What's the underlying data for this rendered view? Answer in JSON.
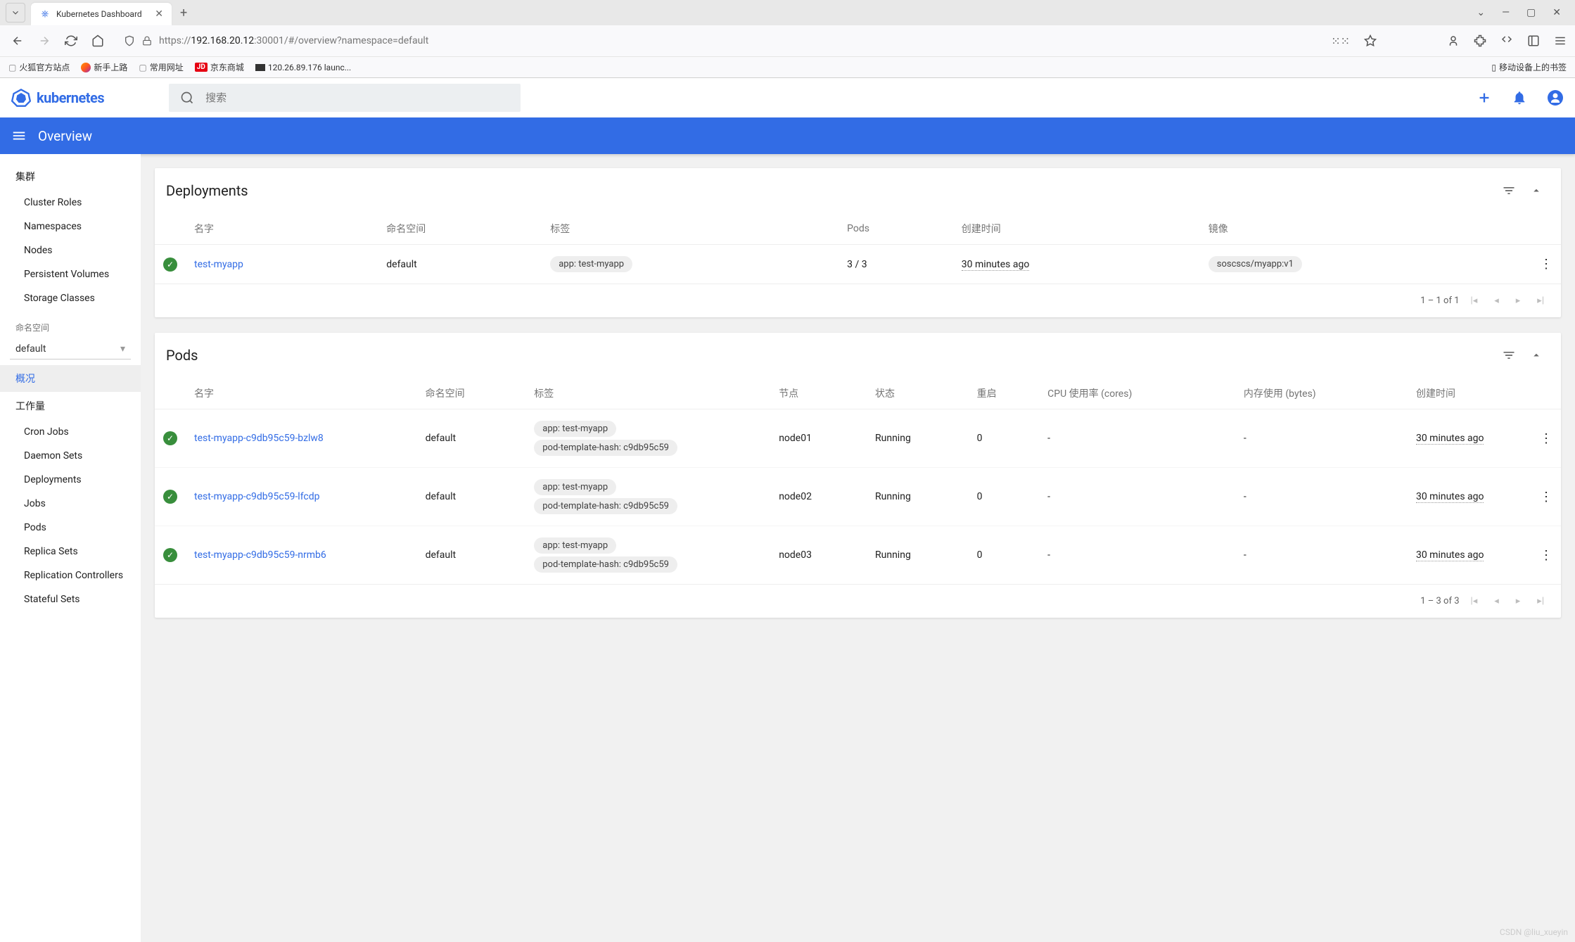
{
  "browser": {
    "tab_title": "Kubernetes Dashboard",
    "url_prefix": "https://",
    "url_host": "192.168.20.12",
    "url_path": ":30001/#/overview?namespace=default",
    "bookmarks": {
      "b1": "火狐官方站点",
      "b2": "新手上路",
      "b3": "常用网址",
      "b4": "京东商城",
      "b5": "120.26.89.176 launc...",
      "mobile": "移动设备上的书签"
    }
  },
  "header": {
    "logo_text": "kubernetes",
    "search_placeholder": "搜索"
  },
  "subheader": {
    "title": "Overview"
  },
  "sidebar": {
    "cluster_heading": "集群",
    "cluster_roles": "Cluster Roles",
    "namespaces": "Namespaces",
    "nodes": "Nodes",
    "persistent_volumes": "Persistent Volumes",
    "storage_classes": "Storage Classes",
    "ns_label": "命名空间",
    "ns_value": "default",
    "overview": "概况",
    "workloads_heading": "工作量",
    "cron_jobs": "Cron Jobs",
    "daemon_sets": "Daemon Sets",
    "deployments": "Deployments",
    "jobs": "Jobs",
    "pods": "Pods",
    "replica_sets": "Replica Sets",
    "replication_controllers": "Replication Controllers",
    "stateful_sets": "Stateful Sets"
  },
  "deployments": {
    "title": "Deployments",
    "headers": {
      "name": "名字",
      "namespace": "命名空间",
      "labels": "标签",
      "pods": "Pods",
      "created": "创建时间",
      "image": "镜像"
    },
    "rows": [
      {
        "name": "test-myapp",
        "namespace": "default",
        "label": "app: test-myapp",
        "pods": "3 / 3",
        "created": "30 minutes ago",
        "image": "soscscs/myapp:v1"
      }
    ],
    "pagination": "1 – 1 of 1"
  },
  "pods": {
    "title": "Pods",
    "headers": {
      "name": "名字",
      "namespace": "命名空间",
      "labels": "标签",
      "node": "节点",
      "status": "状态",
      "restarts": "重启",
      "cpu": "CPU 使用率 (cores)",
      "memory": "内存使用 (bytes)",
      "created": "创建时间"
    },
    "rows": [
      {
        "name": "test-myapp-c9db95c59-bzlw8",
        "namespace": "default",
        "label1": "app: test-myapp",
        "label2": "pod-template-hash: c9db95c59",
        "node": "node01",
        "status": "Running",
        "restarts": "0",
        "cpu": "-",
        "memory": "-",
        "created": "30 minutes ago"
      },
      {
        "name": "test-myapp-c9db95c59-lfcdp",
        "namespace": "default",
        "label1": "app: test-myapp",
        "label2": "pod-template-hash: c9db95c59",
        "node": "node02",
        "status": "Running",
        "restarts": "0",
        "cpu": "-",
        "memory": "-",
        "created": "30 minutes ago"
      },
      {
        "name": "test-myapp-c9db95c59-nrmb6",
        "namespace": "default",
        "label1": "app: test-myapp",
        "label2": "pod-template-hash: c9db95c59",
        "node": "node03",
        "status": "Running",
        "restarts": "0",
        "cpu": "-",
        "memory": "-",
        "created": "30 minutes ago"
      }
    ],
    "pagination": "1 – 3 of 3"
  },
  "watermark": "CSDN @liu_xueyin"
}
